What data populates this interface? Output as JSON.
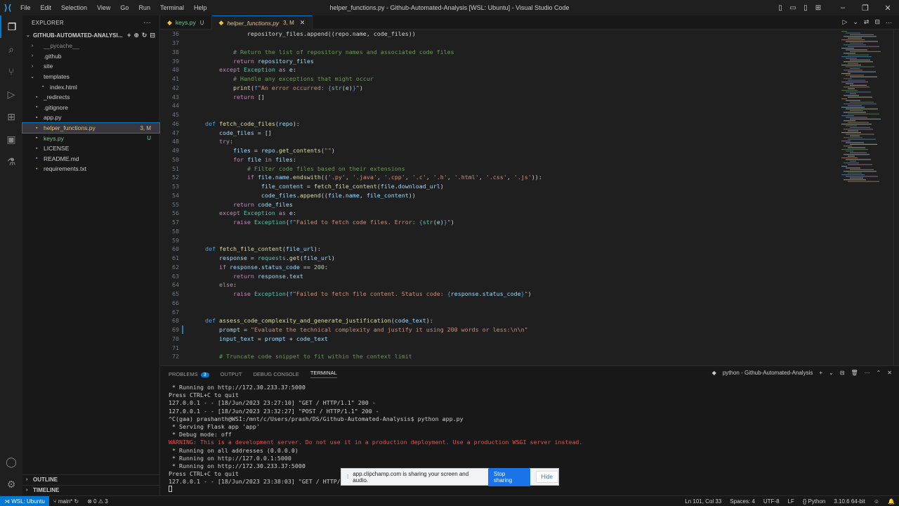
{
  "titlebar": {
    "menu": [
      "File",
      "Edit",
      "Selection",
      "View",
      "Go",
      "Run",
      "Terminal",
      "Help"
    ],
    "title": "helper_functions.py - Github-Automated-Analysis [WSL: Ubuntu] - Visual Studio Code"
  },
  "sidebar": {
    "header": "EXPLORER",
    "root": "GITHUB-AUTOMATED-ANALYSI...",
    "items": [
      {
        "label": "__pycache__",
        "chev": "›",
        "indent": 1,
        "cls": "ignored",
        "icon": "folder-icon"
      },
      {
        "label": ".github",
        "chev": "›",
        "indent": 1,
        "cls": "",
        "icon": "folder-icon"
      },
      {
        "label": "site",
        "chev": "›",
        "indent": 1,
        "cls": "",
        "icon": "folder-icon"
      },
      {
        "label": "templates",
        "chev": "⌄",
        "indent": 1,
        "cls": "",
        "icon": "folder-icon"
      },
      {
        "label": "index.html",
        "chev": "",
        "indent": 2,
        "cls": "",
        "icon": "html-file-icon"
      },
      {
        "label": "_redirects",
        "chev": "",
        "indent": 1,
        "cls": "",
        "icon": "file-icon"
      },
      {
        "label": ".gitignore",
        "chev": "",
        "indent": 1,
        "cls": "",
        "icon": "file-icon"
      },
      {
        "label": "app.py",
        "chev": "",
        "indent": 1,
        "cls": "",
        "icon": "python-file-icon"
      },
      {
        "label": "helper_functions.py",
        "chev": "",
        "indent": 1,
        "cls": "modified selected",
        "icon": "python-file-icon",
        "badge": "3, M"
      },
      {
        "label": "keys.py",
        "chev": "",
        "indent": 1,
        "cls": "untracked",
        "icon": "python-file-icon",
        "badge": "U"
      },
      {
        "label": "LICENSE",
        "chev": "",
        "indent": 1,
        "cls": "",
        "icon": "license-file-icon"
      },
      {
        "label": "README.md",
        "chev": "",
        "indent": 1,
        "cls": "",
        "icon": "markdown-file-icon"
      },
      {
        "label": "requirements.txt",
        "chev": "",
        "indent": 1,
        "cls": "",
        "icon": "text-file-icon"
      }
    ],
    "outline": "OUTLINE",
    "timeline": "TIMELINE"
  },
  "tabs": [
    {
      "name": "keys.py",
      "status": "U",
      "active": false
    },
    {
      "name": "helper_functions.py",
      "status": "3, M",
      "active": true
    }
  ],
  "editor": {
    "lines": [
      {
        "n": "36",
        "h": "                repository_files.append((repo.name, code_files))"
      },
      {
        "n": "37",
        "h": ""
      },
      {
        "n": "38",
        "h": "            <span class='c'># Return the list of repository names and associated code files</span>"
      },
      {
        "n": "39",
        "h": "            <span class='k'>return</span> <span class='v'>repository_files</span>"
      },
      {
        "n": "40",
        "h": "        <span class='k'>except</span> <span class='t'>Exception</span> <span class='k'>as</span> <span class='v'>e</span>:"
      },
      {
        "n": "41",
        "h": "            <span class='c'># Handle any exceptions that might occur</span>"
      },
      {
        "n": "42",
        "h": "            <span class='f'>print</span>(<span class='kd'>f</span><span class='s'>\"An error occurred: </span><span class='kd'>{</span><span class='t'>str</span>(<span class='v'>e</span>)<span class='kd'>}</span><span class='s'>\"</span>)"
      },
      {
        "n": "43",
        "h": "            <span class='k'>return</span> []"
      },
      {
        "n": "44",
        "h": ""
      },
      {
        "n": "45",
        "h": ""
      },
      {
        "n": "46",
        "h": "    <span class='kd'>def</span> <span class='f'>fetch_code_files</span>(<span class='v'>repo</span>):"
      },
      {
        "n": "47",
        "h": "        <span class='v'>code_files</span> = []"
      },
      {
        "n": "48",
        "h": "        <span class='k'>try</span>:"
      },
      {
        "n": "49",
        "h": "            <span class='v'>files</span> = <span class='v'>repo</span>.<span class='f'>get_contents</span>(<span class='s'>\"\"</span>)"
      },
      {
        "n": "50",
        "h": "            <span class='k'>for</span> <span class='v'>file</span> <span class='k'>in</span> <span class='v'>files</span>:"
      },
      {
        "n": "51",
        "h": "                <span class='c'># Filter code files based on their extensions</span>"
      },
      {
        "n": "52",
        "h": "                <span class='k'>if</span> <span class='v'>file</span>.<span class='v'>name</span>.<span class='f'>endswith</span>((<span class='s'>'.py'</span>, <span class='s'>'.java'</span>, <span class='s'>'.cpp'</span>, <span class='s'>'.c'</span>, <span class='s'>'.h'</span>, <span class='s'>'.html'</span>, <span class='s'>'.css'</span>, <span class='s'>'.js'</span>)):"
      },
      {
        "n": "53",
        "h": "                    <span class='v'>file_content</span> = <span class='f'>fetch_file_content</span>(<span class='v'>file</span>.<span class='v'>download_url</span>)"
      },
      {
        "n": "54",
        "h": "                    <span class='v'>code_files</span>.<span class='f'>append</span>((<span class='v'>file</span>.<span class='v'>name</span>, <span class='v'>file_content</span>))"
      },
      {
        "n": "55",
        "h": "            <span class='k'>return</span> <span class='v'>code_files</span>"
      },
      {
        "n": "56",
        "h": "        <span class='k'>except</span> <span class='t'>Exception</span> <span class='k'>as</span> <span class='v'>e</span>:"
      },
      {
        "n": "57",
        "h": "            <span class='k'>raise</span> <span class='t'>Exception</span>(<span class='kd'>f</span><span class='s'>\"Failed to fetch code files. Error: </span><span class='kd'>{</span><span class='t'>str</span>(<span class='v'>e</span>)<span class='kd'>}</span><span class='s'>\"</span>)"
      },
      {
        "n": "58",
        "h": ""
      },
      {
        "n": "59",
        "h": ""
      },
      {
        "n": "60",
        "h": "    <span class='kd'>def</span> <span class='f'>fetch_file_content</span>(<span class='v'>file_url</span>):"
      },
      {
        "n": "61",
        "h": "        <span class='v'>response</span> = <span class='t'>requests</span>.<span class='f'>get</span>(<span class='v'>file_url</span>)"
      },
      {
        "n": "62",
        "h": "        <span class='k'>if</span> <span class='v'>response</span>.<span class='v'>status_code</span> == <span class='n'>200</span>:"
      },
      {
        "n": "63",
        "h": "            <span class='k'>return</span> <span class='v'>response</span>.<span class='v'>text</span>"
      },
      {
        "n": "64",
        "h": "        <span class='k'>else</span>:"
      },
      {
        "n": "65",
        "h": "            <span class='k'>raise</span> <span class='t'>Exception</span>(<span class='kd'>f</span><span class='s'>\"Failed to fetch file content. Status code: </span><span class='kd'>{</span><span class='v'>response</span>.<span class='v'>status_code</span><span class='kd'>}</span><span class='s'>\"</span>)"
      },
      {
        "n": "66",
        "h": ""
      },
      {
        "n": "67",
        "h": ""
      },
      {
        "n": "68",
        "h": "    <span class='kd'>def</span> <span class='f'>assess_code_complexity_and_generate_justification</span>(<span class='v'>code_text</span>):"
      },
      {
        "n": "69",
        "h": "        <span class='v'>prompt</span> = <span class='s'>\"Evaluate the technical complexity and justify it using 200 words or less:\\n\\n\"</span>"
      },
      {
        "n": "70",
        "h": "        <span class='v'>input_text</span> = <span class='v'>prompt</span> + <span class='v'>code_text</span>"
      },
      {
        "n": "71",
        "h": ""
      },
      {
        "n": "72",
        "h": "        <span class='c'># Truncate code snippet to fit within the context limit</span>"
      }
    ]
  },
  "panel": {
    "tabs": [
      "PROBLEMS",
      "OUTPUT",
      "DEBUG CONSOLE",
      "TERMINAL"
    ],
    "problems_count": "3",
    "terminal_name": "python - Github-Automated-Analysis",
    "lines": [
      {
        "t": " * Running on http://172.30.233.37:5000",
        "c": ""
      },
      {
        "t": "Press CTRL+C to quit",
        "c": ""
      },
      {
        "t": "127.0.0.1 - - [18/Jun/2023 23:27:10] \"GET / HTTP/1.1\" 200 -",
        "c": ""
      },
      {
        "t": "127.0.0.1 - - [18/Jun/2023 23:32:27] \"POST / HTTP/1.1\" 200 -",
        "c": ""
      },
      {
        "t": "^C(gaa) prashanth@WSI:/mnt/c/Users/prash/DS/Github-Automated-Analysis$ python app.py",
        "c": "prompt"
      },
      {
        "t": " * Serving Flask app 'app'",
        "c": ""
      },
      {
        "t": " * Debug mode: off",
        "c": ""
      },
      {
        "t": "WARNING: This is a development server. Do not use it in a production deployment. Use a production WSGI server instead.",
        "c": "warn"
      },
      {
        "t": " * Running on all addresses (0.0.0.0)",
        "c": ""
      },
      {
        "t": " * Running on http://127.0.0.1:5000",
        "c": ""
      },
      {
        "t": " * Running on http://172.30.233.37:5000",
        "c": ""
      },
      {
        "t": "Press CTRL+C to quit",
        "c": ""
      },
      {
        "t": "127.0.0.1 - - [18/Jun/2023 23:38:03] \"GET / HTTP/1.1",
        "c": ""
      }
    ]
  },
  "share": {
    "text": "app.clipchamp.com is sharing your screen and audio.",
    "stop": "Stop sharing",
    "hide": "Hide"
  },
  "statusbar": {
    "remote": "WSL: Ubuntu",
    "branch": "main*",
    "problems": "⊗ 0 ⚠ 3",
    "position": "Ln 101, Col 33",
    "spaces": "Spaces: 4",
    "encoding": "UTF-8",
    "eol": "LF",
    "language": "Python",
    "interpreter": "3.10.6 64-bit"
  }
}
